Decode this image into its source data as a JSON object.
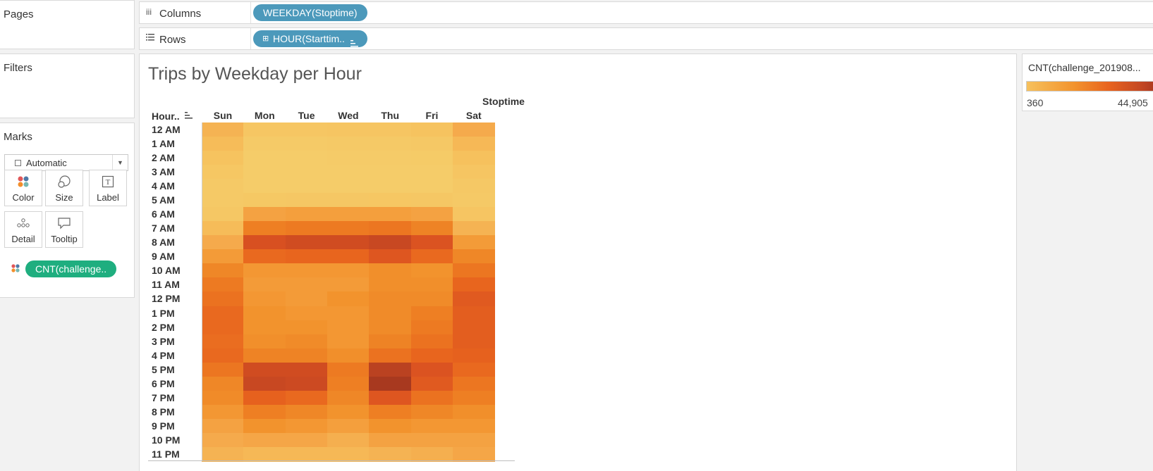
{
  "left": {
    "pages_title": "Pages",
    "filters_title": "Filters",
    "marks_title": "Marks",
    "mark_type": "Automatic",
    "mark_buttons": {
      "color": "Color",
      "size": "Size",
      "label": "Label",
      "detail": "Detail",
      "tooltip": "Tooltip"
    },
    "color_pill": "CNT(challenge.."
  },
  "shelves": {
    "columns_label": "Columns",
    "columns_pill": "WEEKDAY(Stoptime)",
    "rows_label": "Rows",
    "rows_pill": "HOUR(Starttim..",
    "columns_icon": "iii",
    "rows_icon": "list-icon"
  },
  "view": {
    "title": "Trips by Weekday per Hour",
    "field_header": "Stoptime",
    "hour_header": "Hour..",
    "sort_icon": "sort-icon"
  },
  "legend": {
    "title": "CNT(challenge_201908...",
    "min": "360",
    "max": "44,905"
  },
  "colors": {
    "pill_blue": "#4c99bb",
    "pill_green": "#1fae7f",
    "ramp": [
      "#f5cd6a",
      "#f6c15d",
      "#f5a84a",
      "#f2932d",
      "#ed7c22",
      "#e8641e",
      "#d95021",
      "#c24622",
      "#a8391f"
    ]
  },
  "chart_data": {
    "type": "heatmap",
    "title": "Trips by Weekday per Hour",
    "x_field": "Stoptime",
    "columns": [
      "Sun",
      "Mon",
      "Tue",
      "Wed",
      "Thu",
      "Fri",
      "Sat"
    ],
    "rows": [
      "12 AM",
      "1 AM",
      "2 AM",
      "3 AM",
      "4 AM",
      "5 AM",
      "6 AM",
      "7 AM",
      "8 AM",
      "9 AM",
      "10 AM",
      "11 AM",
      "12 PM",
      "1 PM",
      "2 PM",
      "3 PM",
      "4 PM",
      "5 PM",
      "6 PM",
      "7 PM",
      "8 PM",
      "9 PM",
      "10 PM",
      "11 PM"
    ],
    "color_range": [
      360,
      44905
    ],
    "values": [
      [
        9000,
        3500,
        3500,
        4000,
        4000,
        5000,
        11000
      ],
      [
        7000,
        1800,
        1800,
        2000,
        2100,
        2600,
        8000
      ],
      [
        5000,
        1000,
        1000,
        1200,
        1200,
        1500,
        6000
      ],
      [
        3200,
        700,
        700,
        700,
        800,
        900,
        4000
      ],
      [
        2200,
        700,
        700,
        700,
        800,
        900,
        2500
      ],
      [
        2000,
        2800,
        3000,
        3000,
        3200,
        3000,
        2200
      ],
      [
        3000,
        13000,
        14000,
        14000,
        14000,
        13000,
        4000
      ],
      [
        7000,
        22000,
        23000,
        23000,
        24000,
        21000,
        9000
      ],
      [
        11000,
        34000,
        36000,
        36000,
        38000,
        33000,
        15000
      ],
      [
        15000,
        27000,
        28000,
        28000,
        32000,
        27000,
        20000
      ],
      [
        20000,
        16000,
        16000,
        16000,
        18000,
        17000,
        24000
      ],
      [
        23000,
        15000,
        15000,
        15000,
        18000,
        18000,
        28000
      ],
      [
        25000,
        16000,
        15000,
        17000,
        19000,
        19000,
        31000
      ],
      [
        27000,
        17000,
        16000,
        16000,
        19000,
        22000,
        30000
      ],
      [
        27000,
        17000,
        17000,
        16000,
        19000,
        23000,
        30000
      ],
      [
        26000,
        18000,
        19000,
        16000,
        21000,
        25000,
        30000
      ],
      [
        27000,
        21000,
        21000,
        18000,
        25000,
        28000,
        29000
      ],
      [
        24000,
        36000,
        36000,
        23000,
        41000,
        33000,
        27000
      ],
      [
        20000,
        38000,
        37000,
        22000,
        44905,
        31000,
        24000
      ],
      [
        19000,
        29000,
        27000,
        20000,
        32000,
        25000,
        22000
      ],
      [
        16000,
        22000,
        20000,
        17000,
        22000,
        20000,
        18000
      ],
      [
        13000,
        17000,
        16000,
        14000,
        17000,
        16000,
        16000
      ],
      [
        11000,
        12000,
        12000,
        10000,
        13000,
        13000,
        13000
      ],
      [
        9000,
        8000,
        8000,
        8000,
        9000,
        10000,
        12000
      ]
    ]
  }
}
